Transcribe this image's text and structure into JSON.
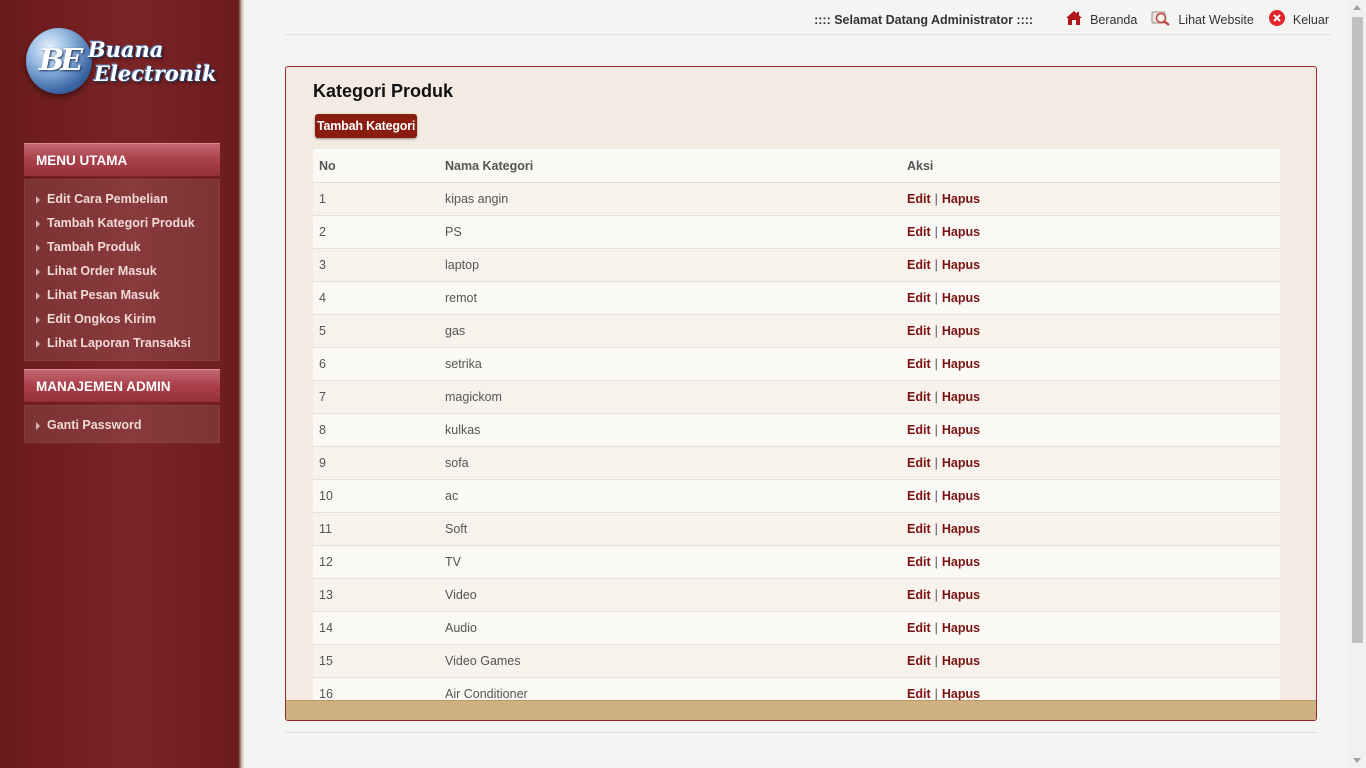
{
  "logo": {
    "mark": "BE",
    "line1": "Buana",
    "line2": "Electronik"
  },
  "sidebar": {
    "main_title": "MENU UTAMA",
    "main_items": [
      {
        "label": "Edit Cara Pembelian"
      },
      {
        "label": "Tambah Kategori Produk"
      },
      {
        "label": "Tambah Produk"
      },
      {
        "label": "Lihat Order Masuk"
      },
      {
        "label": "Lihat Pesan Masuk"
      },
      {
        "label": "Edit Ongkos Kirim"
      },
      {
        "label": "Lihat Laporan Transaksi"
      }
    ],
    "admin_title": "MANAJEMEN ADMIN",
    "admin_items": [
      {
        "label": "Ganti Password"
      }
    ]
  },
  "header": {
    "welcome": ":::: Selamat Datang Administrator ::::",
    "links": {
      "home": {
        "label": "Beranda",
        "icon": "home-icon"
      },
      "website": {
        "label": "Lihat Website",
        "icon": "magnifier-icon"
      },
      "logout": {
        "label": "Keluar",
        "icon": "close-icon"
      }
    }
  },
  "main": {
    "title": "Kategori Produk",
    "add_button": "Tambah Kategori",
    "columns": {
      "no": "No",
      "name": "Nama Kategori",
      "action": "Aksi"
    },
    "edit_label": "Edit",
    "separator": "|",
    "delete_label": "Hapus",
    "rows": [
      {
        "no": "1",
        "name": "kipas angin"
      },
      {
        "no": "2",
        "name": "PS"
      },
      {
        "no": "3",
        "name": "laptop"
      },
      {
        "no": "4",
        "name": "remot"
      },
      {
        "no": "5",
        "name": "gas"
      },
      {
        "no": "6",
        "name": "setrika"
      },
      {
        "no": "7",
        "name": "magickom"
      },
      {
        "no": "8",
        "name": "kulkas"
      },
      {
        "no": "9",
        "name": "sofa"
      },
      {
        "no": "10",
        "name": "ac"
      },
      {
        "no": "11",
        "name": "Soft"
      },
      {
        "no": "12",
        "name": "TV"
      },
      {
        "no": "13",
        "name": "Video"
      },
      {
        "no": "14",
        "name": "Audio"
      },
      {
        "no": "15",
        "name": "Video Games"
      },
      {
        "no": "16",
        "name": "Air Conditioner"
      }
    ]
  },
  "colors": {
    "sidebar": "#7b2426",
    "accent": "#8a1c0f",
    "action_link": "#7a1212",
    "panel_bg": "#f3ebe1",
    "panel_footer": "#cfb181"
  }
}
